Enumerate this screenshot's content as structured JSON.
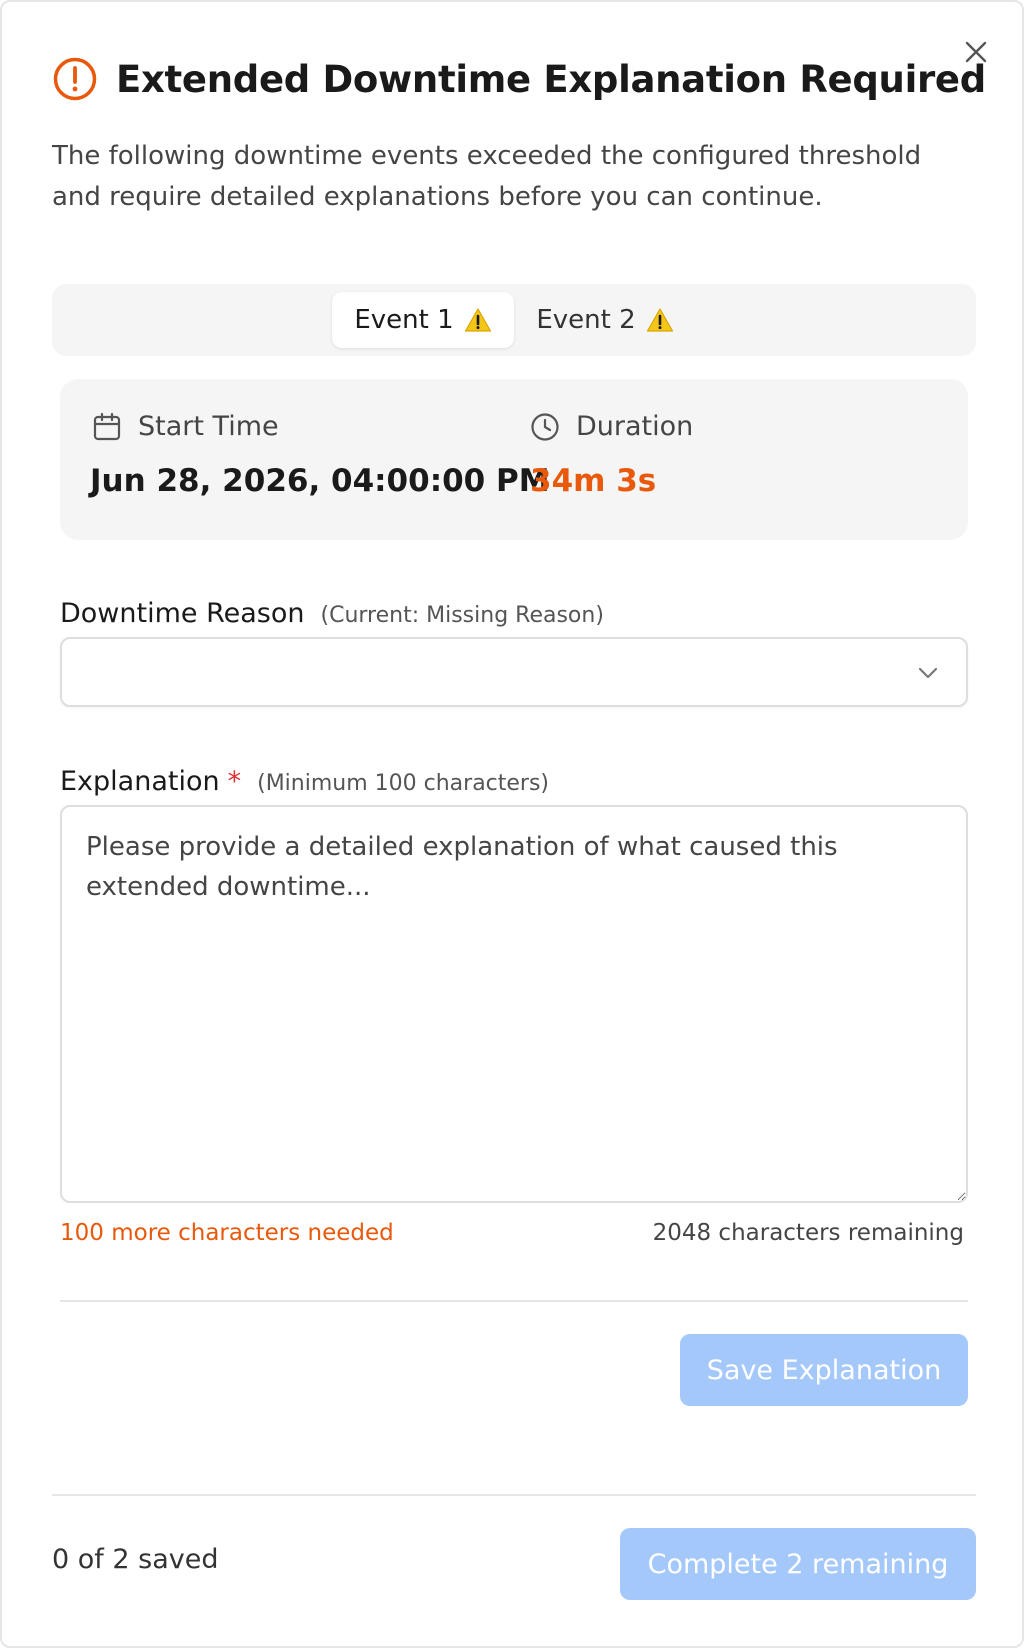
{
  "dialog": {
    "title": "Extended Downtime Explanation Required",
    "description": "The following downtime events exceeded the configured threshold and require detailed explanations before you can continue.",
    "close_icon": "close-icon",
    "title_icon": "alert-circle-icon"
  },
  "tabs": [
    {
      "label": "Event 1",
      "icon": "warning-icon",
      "active": true
    },
    {
      "label": "Event 2",
      "icon": "warning-icon",
      "active": false
    }
  ],
  "event": {
    "start_label": "Start Time",
    "start_value": "Jun 28, 2026, 04:00:00 PM",
    "start_icon": "calendar-icon",
    "duration_label": "Duration",
    "duration_value": "34m 3s",
    "duration_icon": "clock-icon"
  },
  "reason": {
    "label": "Downtime Reason",
    "hint": "(Current: Missing Reason)",
    "value": ""
  },
  "explanation": {
    "label": "Explanation",
    "required_mark": "*",
    "hint": "(Minimum 100 characters)",
    "placeholder": "Please provide a detailed explanation of what caused this extended downtime...",
    "value": "",
    "needed_text": "100 more characters needed",
    "remaining_text": "2048 characters remaining"
  },
  "actions": {
    "save_label": "Save Explanation",
    "complete_label": "Complete 2 remaining",
    "saved_status": "0 of 2 saved"
  },
  "colors": {
    "accent_orange": "#e8590c",
    "button_disabled": "#a5c8fb",
    "required_red": "#e03131"
  }
}
